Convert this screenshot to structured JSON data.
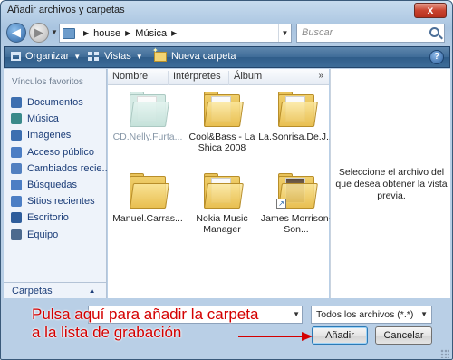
{
  "window": {
    "title": "Añadir archivos y carpetas",
    "close_label": "x"
  },
  "address": {
    "breadcrumb": [
      "house",
      "Música"
    ],
    "search_placeholder": "Buscar"
  },
  "toolbar": {
    "organize_label": "Organizar",
    "views_label": "Vistas",
    "new_folder_label": "Nueva carpeta",
    "help_label": "?"
  },
  "sidebar": {
    "header": "Vínculos favoritos",
    "items": [
      {
        "label": "Documentos",
        "icon": "documents-icon",
        "color": "#3d6fb0"
      },
      {
        "label": "Música",
        "icon": "music-icon",
        "color": "#3a8a8a"
      },
      {
        "label": "Imágenes",
        "icon": "pictures-icon",
        "color": "#3d6fb0"
      },
      {
        "label": "Acceso público",
        "icon": "public-icon",
        "color": "#4c7ec4"
      },
      {
        "label": "Cambiados recie...",
        "icon": "recent-changes-icon",
        "color": "#5280c0"
      },
      {
        "label": "Búsquedas",
        "icon": "searches-icon",
        "color": "#4c7ec4"
      },
      {
        "label": "Sitios recientes",
        "icon": "recent-places-icon",
        "color": "#4c7ec4"
      },
      {
        "label": "Escritorio",
        "icon": "desktop-icon",
        "color": "#2e5d9b"
      },
      {
        "label": "Equipo",
        "icon": "computer-icon",
        "color": "#4c6a8e"
      }
    ],
    "folders_label": "Carpetas"
  },
  "columns": [
    "Nombre",
    "Intérpretes",
    "Álbum"
  ],
  "files": [
    {
      "label": "CD.Nelly.Furta...",
      "selected": true,
      "style": "teal",
      "shortcut": false
    },
    {
      "label": "Cool&Bass - La Shica 2008",
      "selected": false,
      "style": "docs",
      "shortcut": false
    },
    {
      "label": "La.Sonrisa.De.J...",
      "selected": false,
      "style": "docs",
      "shortcut": false
    },
    {
      "label": "Manuel.Carras...",
      "selected": false,
      "style": "plain",
      "shortcut": false
    },
    {
      "label": "Nokia Music Manager",
      "selected": false,
      "style": "docs",
      "shortcut": false
    },
    {
      "label": "James Morrison-Son...",
      "selected": false,
      "style": "photo",
      "shortcut": true
    }
  ],
  "preview": {
    "text": "Seleccione el archivo del que desea obtener la vista previa."
  },
  "filename": {
    "value": ""
  },
  "filetype": {
    "selected": "Todos los archivos (*.*)"
  },
  "buttons": {
    "open": "Añadir",
    "cancel": "Cancelar"
  },
  "annotation": {
    "line1": "Pulsa aquí para añadir la carpeta",
    "line2": "a la lista de grabación",
    "color": "#d40000"
  }
}
